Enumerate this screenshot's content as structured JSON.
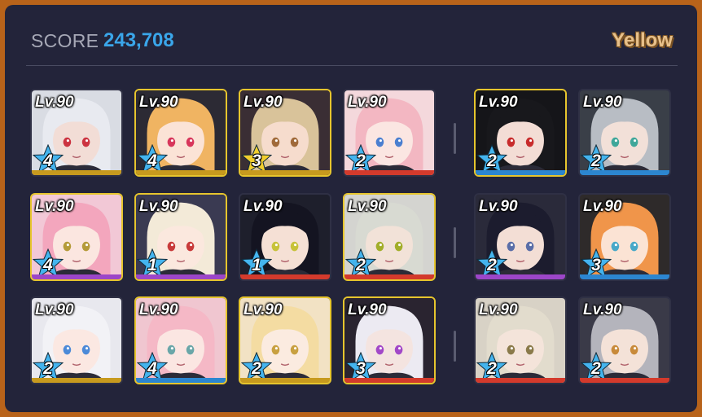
{
  "header": {
    "score_label": "SCORE",
    "score_value": "243,708",
    "team_name": "Yellow"
  },
  "cards": [
    {
      "level": "Lv.90",
      "stars": "4",
      "selected": false,
      "bar": "#c79a1e",
      "star": "#44b4ee",
      "bg": "#d9dce3",
      "hair": "#e8eaf0",
      "skin": "#f2ddd6",
      "eye": "#cc3340"
    },
    {
      "level": "Lv.90",
      "stars": "4",
      "selected": true,
      "bar": "#c79a1e",
      "star": "#44b4ee",
      "bg": "#2c2a34",
      "hair": "#f0b462",
      "skin": "#fbe3d6",
      "eye": "#d8365b"
    },
    {
      "level": "Lv.90",
      "stars": "3",
      "selected": true,
      "bar": "#c79a1e",
      "star": "#f2cf2e",
      "bg": "#3a2e34",
      "hair": "#d9c39a",
      "skin": "#f6dccd",
      "eye": "#a06a3a"
    },
    {
      "level": "Lv.90",
      "stars": "2",
      "selected": false,
      "bar": "#d33a2c",
      "star": "#44b4ee",
      "bg": "#f4d8dc",
      "hair": "#f3b7c2",
      "skin": "#fbe6e2",
      "eye": "#4b7fd0"
    },
    {
      "level": "Lv.90",
      "stars": "2",
      "selected": true,
      "bar": "#2c86d0",
      "star": "#44b4ee",
      "bg": "#151519",
      "hair": "#18181c",
      "skin": "#f3ddd5",
      "eye": "#c82c2c"
    },
    {
      "level": "Lv.90",
      "stars": "2",
      "selected": false,
      "bar": "#2c86d0",
      "star": "#44b4ee",
      "bg": "#3a3f48",
      "hair": "#b8bdc4",
      "skin": "#f2e0d8",
      "eye": "#3fa79a"
    },
    {
      "level": "Lv.90",
      "stars": "4",
      "selected": true,
      "bar": "#9c46c8",
      "star": "#44b4ee",
      "bg": "#f2c8d6",
      "hair": "#f3a6bd",
      "skin": "#fbe6e0",
      "eye": "#b59b3a"
    },
    {
      "level": "Lv.90",
      "stars": "1",
      "selected": true,
      "bar": "#9c46c8",
      "star": "#44b4ee",
      "bg": "#3a3a52",
      "hair": "#f3ead8",
      "skin": "#fbe8de",
      "eye": "#c83a3a"
    },
    {
      "level": "Lv.90",
      "stars": "1",
      "selected": false,
      "bar": "#d33a2c",
      "star": "#44b4ee",
      "bg": "#1e1f2c",
      "hair": "#141421",
      "skin": "#f5e0d5",
      "eye": "#c7c23a"
    },
    {
      "level": "Lv.90",
      "stars": "2",
      "selected": true,
      "bar": "#d33a2c",
      "star": "#44b4ee",
      "bg": "#d4d4d0",
      "hair": "#d8dad2",
      "skin": "#f2e2d8",
      "eye": "#a2ae2a"
    },
    {
      "level": "Lv.90",
      "stars": "2",
      "selected": false,
      "bar": "#9c46c8",
      "star": "#44b4ee",
      "bg": "#2a2a3a",
      "hair": "#1c1c2e",
      "skin": "#f3ded5",
      "eye": "#5a6ea8"
    },
    {
      "level": "Lv.90",
      "stars": "3",
      "selected": false,
      "bar": "#2c86d0",
      "star": "#44b4ee",
      "bg": "#2e2a2a",
      "hair": "#f0954a",
      "skin": "#fbe3d4",
      "eye": "#48a8c8"
    },
    {
      "level": "Lv.90",
      "stars": "2",
      "selected": false,
      "bar": "#c79a1e",
      "star": "#44b4ee",
      "bg": "#e8e8ee",
      "hair": "#f2f2f6",
      "skin": "#fbe8e2",
      "eye": "#4c8ad8"
    },
    {
      "level": "Lv.90",
      "stars": "4",
      "selected": true,
      "bar": "#2c86d0",
      "star": "#44b4ee",
      "bg": "#f0c6d0",
      "hair": "#f5b8c6",
      "skin": "#fbe6e2",
      "eye": "#6aa6a8"
    },
    {
      "level": "Lv.90",
      "stars": "2",
      "selected": true,
      "bar": "#c79a1e",
      "star": "#44b4ee",
      "bg": "#f2e2c4",
      "hair": "#f4dca2",
      "skin": "#fbebe0",
      "eye": "#c8a040"
    },
    {
      "level": "Lv.90",
      "stars": "3",
      "selected": true,
      "bar": "#d33a2c",
      "star": "#44b4ee",
      "bg": "#2a2430",
      "hair": "#eceaf2",
      "skin": "#f4e4e0",
      "eye": "#a248c8"
    },
    {
      "level": "Lv.90",
      "stars": "2",
      "selected": false,
      "bar": "#d33a2c",
      "star": "#44b4ee",
      "bg": "#d8d2c6",
      "hair": "#e2dccd",
      "skin": "#f4e4da",
      "eye": "#8a7a4a"
    },
    {
      "level": "Lv.90",
      "stars": "2",
      "selected": false,
      "bar": "#d33a2c",
      "star": "#44b4ee",
      "bg": "#3a3a48",
      "hair": "#b4b4bc",
      "skin": "#f4e2d8",
      "eye": "#c88a3a"
    }
  ]
}
